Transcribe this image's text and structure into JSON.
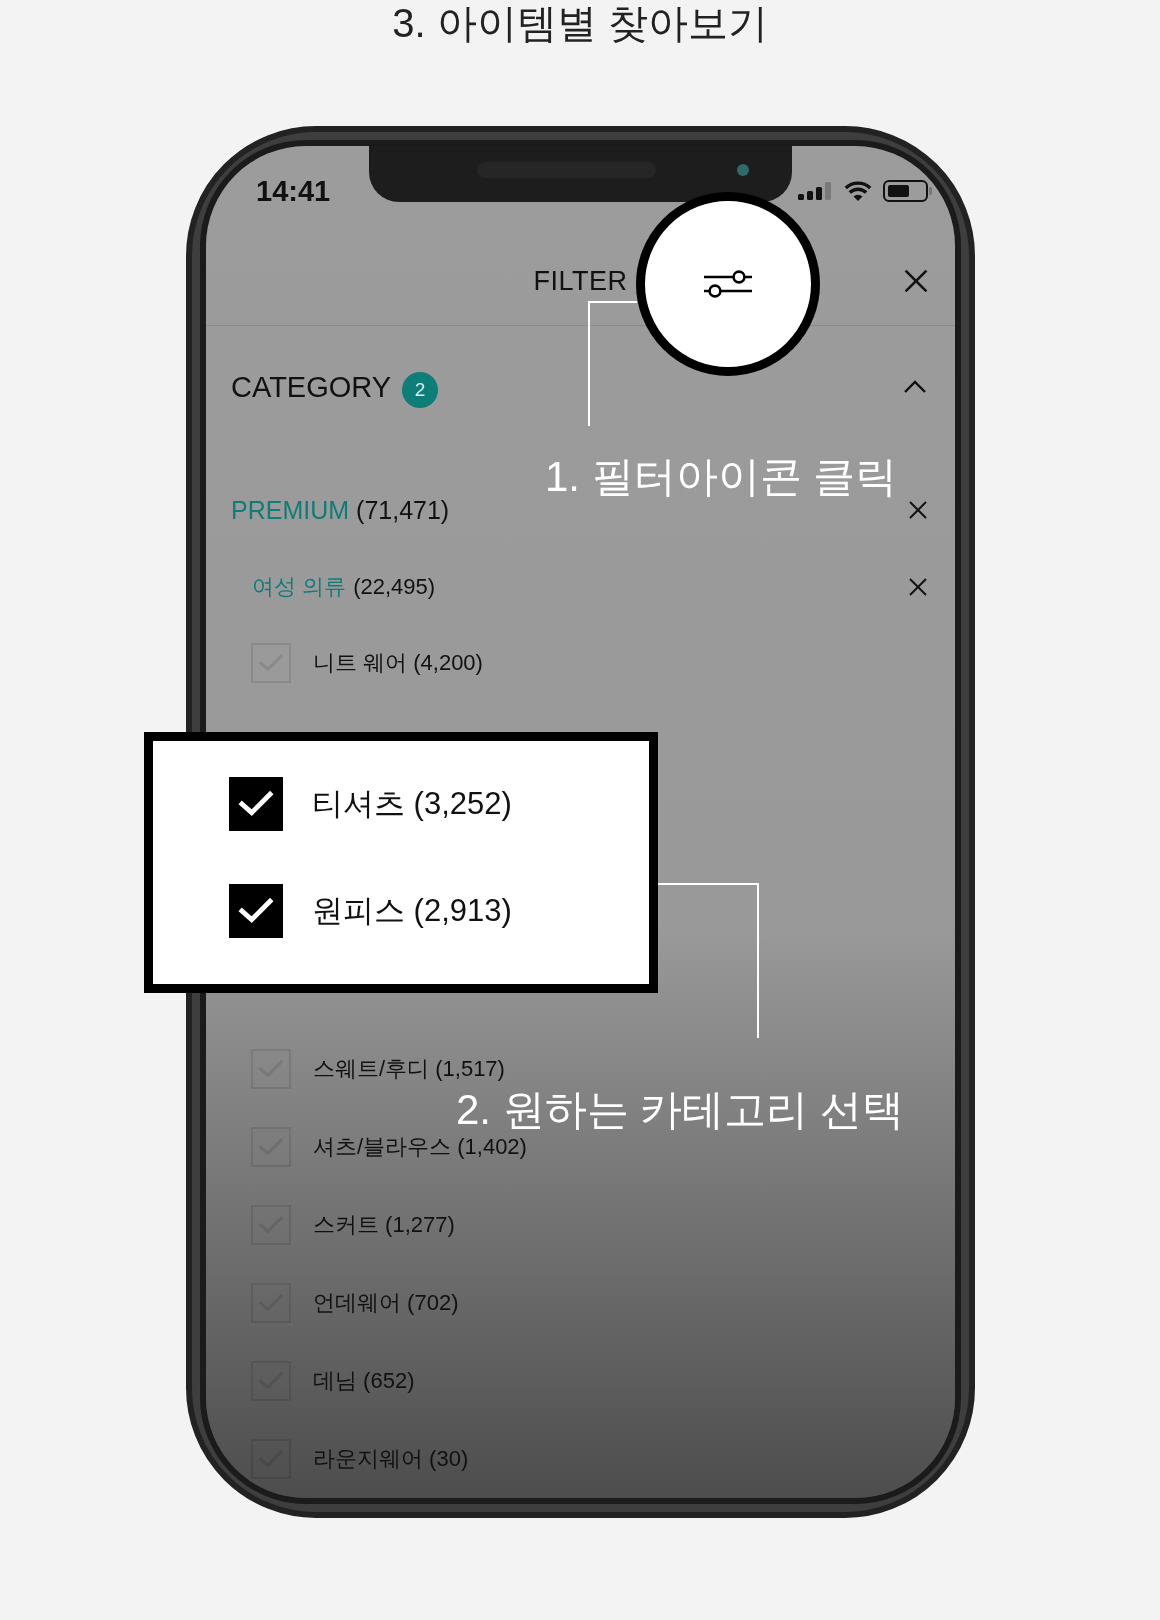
{
  "title": "3. 아이템별 찾아보기",
  "phone": {
    "status_bar": {
      "time": "14:41"
    },
    "header": {
      "title": "FILTER"
    },
    "category": {
      "label": "CATEGORY",
      "badge": "2",
      "expanded": true
    },
    "premium": {
      "label": "PREMIUM",
      "count": "(71,471)"
    },
    "subgroup": {
      "label": "여성 의류",
      "count": "(22,495)"
    },
    "items": [
      {
        "label": "니트 웨어 (4,200)",
        "checked": false
      },
      {
        "label": "스웨트/후디 (1,517)",
        "checked": false
      },
      {
        "label": "셔츠/블라우스 (1,402)",
        "checked": false
      },
      {
        "label": "스커트 (1,277)",
        "checked": false
      },
      {
        "label": "언데웨어 (702)",
        "checked": false
      },
      {
        "label": "데님 (652)",
        "checked": false
      },
      {
        "label": "라운지웨어 (30)",
        "checked": false
      }
    ]
  },
  "popup": {
    "items": [
      {
        "label": "티셔츠 (3,252)",
        "checked": true
      },
      {
        "label": "원피스 (2,913)",
        "checked": true
      }
    ]
  },
  "callouts": [
    {
      "text": "1. 필터아이콘 클릭"
    },
    {
      "text": "2. 원하는 카테고리 선택"
    }
  ]
}
